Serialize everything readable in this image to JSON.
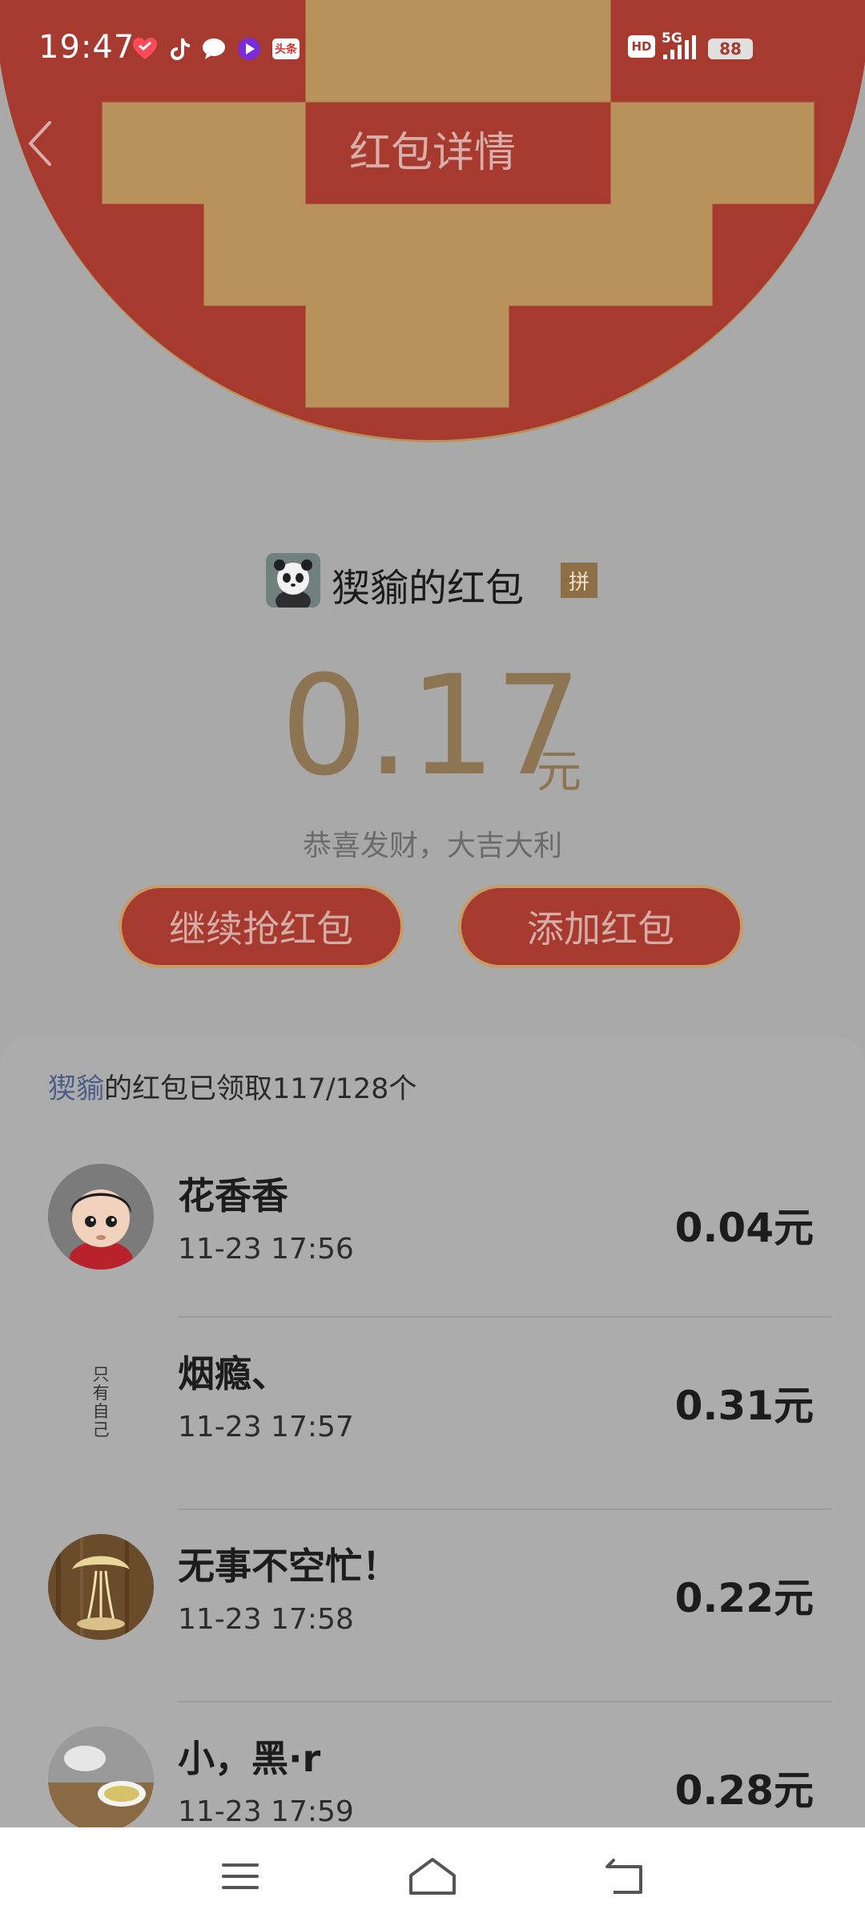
{
  "status_bar": {
    "time": "19:47",
    "app_icons": [
      "heart-app-icon",
      "tiktok-icon",
      "message-icon",
      "video-app-icon",
      "toutiao-icon"
    ],
    "toutiao_label": "头条",
    "hd_label": "HD",
    "network_label": "5G",
    "battery_level": "88"
  },
  "header": {
    "title": "红包详情"
  },
  "summary": {
    "sender_name": "猰貐的红包",
    "pin_label": "拼",
    "amount": "0.17",
    "amount_unit": "元",
    "blessing": "恭喜发财，大吉大利",
    "continue_button": "继续抢红包",
    "add_button": "添加红包"
  },
  "records": {
    "sender": "猰貐",
    "summary_text": "的红包已领取117/128个",
    "items": [
      {
        "name": "花香香",
        "time": "11-23 17:56",
        "amount": "0.04元"
      },
      {
        "name": "烟瘾、",
        "time": "11-23 17:57",
        "amount": "0.31元"
      },
      {
        "name": "无事不空忙！",
        "time": "11-23 17:58",
        "amount": "0.22元"
      },
      {
        "name": "小，黑·r",
        "time": "11-23 17:59",
        "amount": "0.28元"
      }
    ],
    "calligraphy_avatar_text": "只有自己"
  },
  "colors": {
    "header_red": "#a63a2f",
    "gold": "#8d7554",
    "link_blue": "#4b5c88"
  }
}
